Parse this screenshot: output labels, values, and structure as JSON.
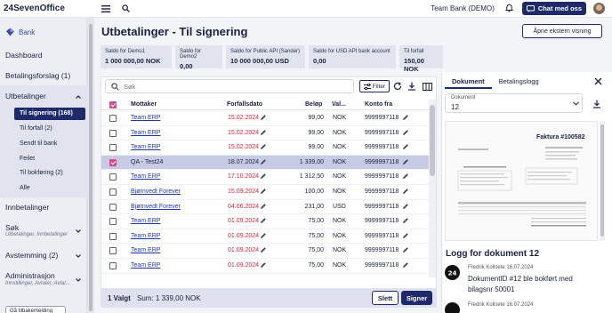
{
  "app": {
    "logo_text": "24SevenOffice",
    "company": "Team Bank (DEMO)",
    "chat_label": "Chat med oss"
  },
  "sidebar": {
    "back_label": "Bank",
    "items": [
      {
        "label": "Dashboard"
      },
      {
        "label": "Betalingsforslag (1)"
      },
      {
        "label": "Utbetalinger"
      },
      {
        "label": "Innbetalinger"
      },
      {
        "label": "Søk",
        "desc": "Utbetalinger, Innbetalinger"
      },
      {
        "label": "Avstemming (2)"
      },
      {
        "label": "Administrasjon",
        "desc": "Innstillinger, Avtaler, Avtal..."
      }
    ],
    "sub_items": [
      {
        "label": "Til signering (168)"
      },
      {
        "label": "Til forfall (2)"
      },
      {
        "label": "Sendt til bank"
      },
      {
        "label": "Feilet"
      },
      {
        "label": "Til bokføring (2)"
      },
      {
        "label": "Alle"
      }
    ],
    "bottom_button": "Gå tilbakemelding"
  },
  "page": {
    "title": "Utbetalinger - Til signering",
    "external_button": "Åpne ekstern visning"
  },
  "balances": [
    {
      "label": "Saldo for Demo1",
      "value": "1 000 000,00 NOK"
    },
    {
      "label": "Saldo for Demo2",
      "value": "0,00"
    },
    {
      "label": "Saldo for Public API (Sander)",
      "value": "10 000 000,00 USD"
    },
    {
      "label": "Saldo for USD API bank account",
      "value": "0,00"
    },
    {
      "label": "Til forfall",
      "value": "150,00 NOK"
    }
  ],
  "toolbar": {
    "search_placeholder": "Søk",
    "filter_label": "Filter"
  },
  "table": {
    "headers": {
      "payee": "Mottaker",
      "due": "Forfallsdato",
      "amount": "Beløp",
      "currency": "Val...",
      "account": "Konto fra"
    },
    "rows": [
      {
        "payee": "Team ERP",
        "due": "15.02.2024",
        "amount": "99,00",
        "currency": "NOK",
        "account": "9999997118",
        "checked": false,
        "selected": false,
        "link": true
      },
      {
        "payee": "Team ERP",
        "due": "15.02.2024",
        "amount": "99,00",
        "currency": "NOK",
        "account": "9999997118",
        "checked": false,
        "selected": false,
        "link": true
      },
      {
        "payee": "Team ERP",
        "due": "15.02.2024",
        "amount": "99,00",
        "currency": "NOK",
        "account": "9999997118",
        "checked": false,
        "selected": false,
        "link": true
      },
      {
        "payee": "QA - Test24",
        "due": "18.07.2024",
        "amount": "1 339,00",
        "currency": "NOK",
        "account": "9999997118",
        "checked": true,
        "selected": true,
        "link": false
      },
      {
        "payee": "Team ERP",
        "due": "17.10.2024",
        "amount": "1 312,50",
        "currency": "NOK",
        "account": "9999997118",
        "checked": false,
        "selected": false,
        "link": true
      },
      {
        "payee": "Bjørnvedt Forever",
        "due": "15.09.2024",
        "amount": "100,00",
        "currency": "NOK",
        "account": "9999997118",
        "checked": false,
        "selected": false,
        "link": true
      },
      {
        "payee": "Bjørnvedt Forever",
        "due": "04.06.2024",
        "amount": "231,00",
        "currency": "USD",
        "account": "9999997118",
        "checked": false,
        "selected": false,
        "link": true
      },
      {
        "payee": "Team ERP",
        "due": "01.09.2024",
        "amount": "75,00",
        "currency": "NOK",
        "account": "9999997118",
        "checked": false,
        "selected": false,
        "link": true
      },
      {
        "payee": "Team ERP",
        "due": "01.09.2024",
        "amount": "75,00",
        "currency": "NOK",
        "account": "9999997118",
        "checked": false,
        "selected": false,
        "link": true
      },
      {
        "payee": "Team ERP",
        "due": "01.09.2024",
        "amount": "75,00",
        "currency": "NOK",
        "account": "9999997118",
        "checked": false,
        "selected": false,
        "link": true
      },
      {
        "payee": "Team ERP",
        "due": "01.09.2024",
        "amount": "75,00",
        "currency": "NOK",
        "account": "9999997118",
        "checked": false,
        "selected": false,
        "link": true
      }
    ]
  },
  "footer": {
    "selected_count": "1 Valgt",
    "sum": "Sum: 1 339,00 NOK",
    "delete_label": "Slett",
    "sign_label": "Signer"
  },
  "panel": {
    "tabs": [
      {
        "label": "Dokument"
      },
      {
        "label": "Betalingslogg"
      }
    ],
    "doc_label": "Dokument",
    "doc_value": "12",
    "invoice_title": "Faktura #100582",
    "log_title": "Logg for dokument 12",
    "log": [
      {
        "meta": "Fredrik Kollsete 16.07.2024",
        "text": "DokumentID #12 ble bokført med bilagsnr 50001"
      },
      {
        "meta": "Fredrik Kollsete 16.07.2024",
        "text": ""
      }
    ]
  },
  "colors": {
    "brand": "#1f2a6b",
    "overdue": "#e0253a",
    "checkbox": "#d64c8a"
  }
}
